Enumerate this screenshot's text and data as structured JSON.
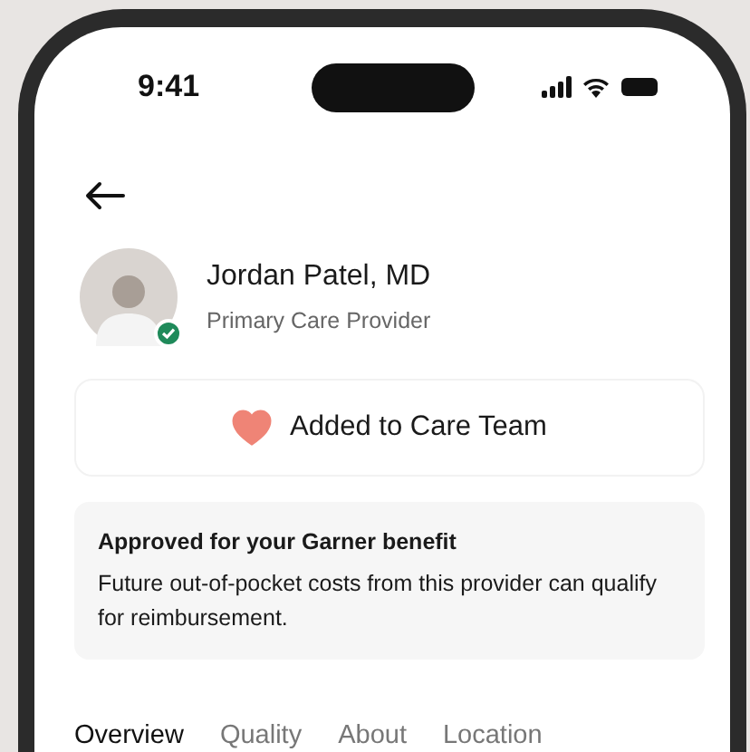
{
  "status_bar": {
    "time": "9:41"
  },
  "provider": {
    "name": "Jordan Patel, MD",
    "role": "Primary Care Provider",
    "verified": true
  },
  "care_team_button": {
    "label": "Added to Care Team",
    "added": true
  },
  "benefit_notice": {
    "title": "Approved for your Garner benefit",
    "text": "Future out-of-pocket costs from this provider can qualify for reimbursement."
  },
  "tabs": [
    {
      "label": "Overview",
      "selected": true
    },
    {
      "label": "Quality",
      "selected": false
    },
    {
      "label": "About",
      "selected": false
    },
    {
      "label": "Location",
      "selected": false
    }
  ]
}
